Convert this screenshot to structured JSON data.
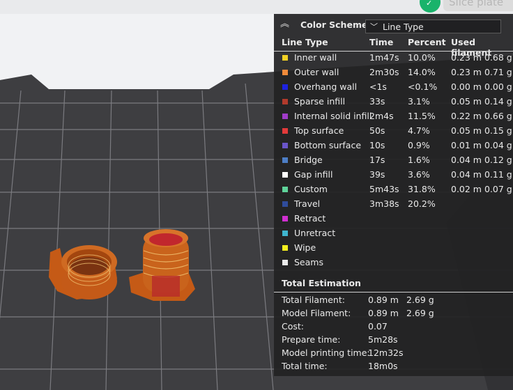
{
  "slice_button": "Slice plate",
  "legend": {
    "collapse_icon": "chevron-up-double-icon",
    "scheme_label": "Color Scheme",
    "scheme_value": "Line Type",
    "headers": {
      "type": "Line Type",
      "time": "Time",
      "percent": "Percent",
      "filament": "Used filament"
    },
    "rows": [
      {
        "color": "#f2d124",
        "name": "Inner wall",
        "time": "1m47s",
        "percent": "10.0%",
        "length": "0.23 m",
        "weight": "0.68 g"
      },
      {
        "color": "#f08a3a",
        "name": "Outer wall",
        "time": "2m30s",
        "percent": "14.0%",
        "length": "0.23 m",
        "weight": "0.71 g"
      },
      {
        "color": "#1d22e0",
        "name": "Overhang wall",
        "time": "<1s",
        "percent": "<0.1%",
        "length": "0.00 m",
        "weight": "0.00 g"
      },
      {
        "color": "#b13a2c",
        "name": "Sparse infill",
        "time": "33s",
        "percent": "3.1%",
        "length": "0.05 m",
        "weight": "0.14 g"
      },
      {
        "color": "#a13cc9",
        "name": "Internal solid infill",
        "time": "2m4s",
        "percent": "11.5%",
        "length": "0.22 m",
        "weight": "0.66 g"
      },
      {
        "color": "#e23a3a",
        "name": "Top surface",
        "time": "50s",
        "percent": "4.7%",
        "length": "0.05 m",
        "weight": "0.15 g"
      },
      {
        "color": "#6a55c9",
        "name": "Bottom surface",
        "time": "10s",
        "percent": "0.9%",
        "length": "0.01 m",
        "weight": "0.04 g"
      },
      {
        "color": "#4d7ec6",
        "name": "Bridge",
        "time": "17s",
        "percent": "1.6%",
        "length": "0.04 m",
        "weight": "0.12 g"
      },
      {
        "color": "#ffffff",
        "name": "Gap infill",
        "time": "39s",
        "percent": "3.6%",
        "length": "0.04 m",
        "weight": "0.11 g"
      },
      {
        "color": "#5fd39a",
        "name": "Custom",
        "time": "5m43s",
        "percent": "31.8%",
        "length": "0.02 m",
        "weight": "0.07 g"
      },
      {
        "color": "#2f4c9c",
        "name": "Travel",
        "time": "3m38s",
        "percent": "20.2%",
        "length": "",
        "weight": ""
      },
      {
        "color": "#cf2fd0",
        "name": "Retract",
        "time": "",
        "percent": "",
        "length": "",
        "weight": ""
      },
      {
        "color": "#3fb6cf",
        "name": "Unretract",
        "time": "",
        "percent": "",
        "length": "",
        "weight": ""
      },
      {
        "color": "#f5ef1e",
        "name": "Wipe",
        "time": "",
        "percent": "",
        "length": "",
        "weight": ""
      },
      {
        "color": "#ebebeb",
        "name": "Seams",
        "time": "",
        "percent": "",
        "length": "",
        "weight": ""
      }
    ]
  },
  "total": {
    "title": "Total Estimation",
    "rows": [
      {
        "key": "Total Filament:",
        "v1": "0.89 m",
        "v2": "2.69 g"
      },
      {
        "key": "Model Filament:",
        "v1": "0.89 m",
        "v2": "2.69 g"
      },
      {
        "key": "Cost:",
        "v1": "0.07",
        "v2": ""
      },
      {
        "key": "Prepare time:",
        "v1": "5m28s",
        "v2": ""
      },
      {
        "key": "Model printing time:",
        "v1": "12m32s",
        "v2": ""
      },
      {
        "key": "Total time:",
        "v1": "18m0s",
        "v2": ""
      }
    ]
  }
}
